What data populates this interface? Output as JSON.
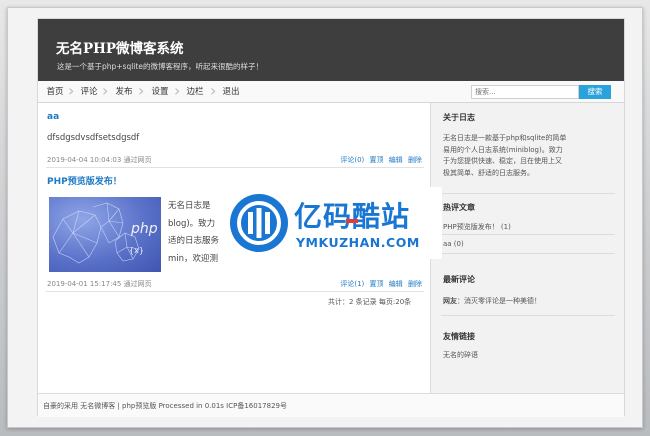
{
  "site": {
    "title": "无名PHP微博客系统",
    "tagline": "这是一个基于php+sqlite的微博客程序，听起来很酷的样子！"
  },
  "nav": {
    "items": [
      "首页",
      "评论",
      "发布",
      "设置",
      "边栏",
      "退出"
    ],
    "search_placeholder": "搜索...",
    "search_button": "搜索"
  },
  "posts": [
    {
      "title": "aa",
      "body": "dfsdgsdvsdfsetsdgsdf",
      "meta": "2019-04-04 10:04:03 通过网页",
      "actions": [
        "评论(0)",
        "置顶",
        "编辑",
        "删除"
      ]
    },
    {
      "title": "PHP预览版发布！",
      "body_lines": [
        "无名日志是",
        "blog)。致力",
        "适的日志服务",
        "min，欢迎测"
      ],
      "meta": "2019-04-01 15:17:45 通过网页",
      "actions": [
        "评论(1)",
        "置顶",
        "编辑",
        "删除"
      ],
      "thumb_text": [
        "php",
        "{x}"
      ]
    }
  ],
  "pager": "共计：2 条记录 每页:20条",
  "sidebar": {
    "about": {
      "title": "关于日志",
      "lines": [
        "无名日志是一款基于php和sqlite的简单",
        "易用的个人日志系统(miniblog)。致力",
        "于为您提供快速、稳定，且在使用上又",
        "极其简单、舒适的日志服务。"
      ]
    },
    "hot": {
      "title": "热评文章",
      "items": [
        "PHP预览版发布！ (1)",
        "aa (0)"
      ]
    },
    "comments": {
      "title": "最新评论",
      "user": "网友",
      "text": "：消灭零评论是一种美德！"
    },
    "links": {
      "title": "友情链接",
      "items": [
        "无名的碎语"
      ]
    }
  },
  "footer": {
    "text": "自豪的采用 无名微博客 | php预览版 Processed in 0.01s ICP备16017829号"
  },
  "watermark": {
    "title": "亿码酷站",
    "subtitle": "YMKUZHAN.COM"
  },
  "colors": {
    "header_bg": "#3e3e3e",
    "link": "#1f7ac4",
    "search_button": "#2aa3dc",
    "watermark": "#1976d2",
    "watermark_accent": "#e53935"
  }
}
